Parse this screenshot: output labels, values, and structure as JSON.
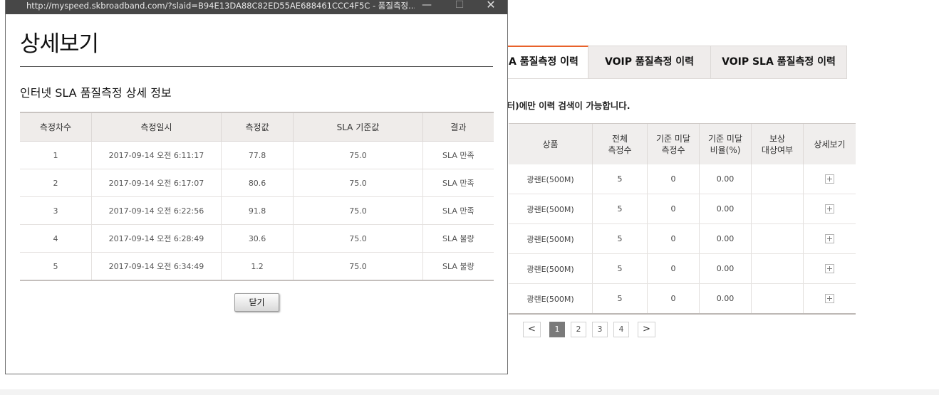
{
  "window": {
    "url": "http://myspeed.skbroadband.com/?slaid=B94E13DA88C82ED55AE688461CCC4F5C - 품질측정...",
    "controls": {
      "minimize": "—",
      "maximize": "☐",
      "close": "✕"
    }
  },
  "popup": {
    "title": "상세보기",
    "subtitle": "인터넷 SLA 품질측정 상세 정보",
    "table": {
      "headers": [
        "측정차수",
        "측정일시",
        "측정값",
        "SLA 기준값",
        "결과"
      ],
      "rows": [
        [
          "1",
          "2017-09-14 오전 6:11:17",
          "77.8",
          "75.0",
          "SLA 만족"
        ],
        [
          "2",
          "2017-09-14 오전 6:17:07",
          "80.6",
          "75.0",
          "SLA 만족"
        ],
        [
          "3",
          "2017-09-14 오전 6:22:56",
          "91.8",
          "75.0",
          "SLA 만족"
        ],
        [
          "4",
          "2017-09-14 오전 6:28:49",
          "30.6",
          "75.0",
          "SLA 불량"
        ],
        [
          "5",
          "2017-09-14 오전 6:34:49",
          "1.2",
          "75.0",
          "SLA 불량"
        ]
      ]
    },
    "close_label": "닫기"
  },
  "page": {
    "tabs": [
      "A 품질측정 이력",
      "VOIP 품질측정 이력",
      "VOIP SLA 품질측정 이력"
    ],
    "notice": "이터)에만 이력 검색이 가능합니다.",
    "list": {
      "headers": [
        "상품",
        "전체\n측정수",
        "기준 미달\n측정수",
        "기준 미달\n비율(%)",
        "보상\n대상여부",
        "상세보기"
      ],
      "rows": [
        [
          "광랜E(500M)",
          "5",
          "0",
          "0.00",
          ""
        ],
        [
          "광랜E(500M)",
          "5",
          "0",
          "0.00",
          ""
        ],
        [
          "광랜E(500M)",
          "5",
          "0",
          "0.00",
          ""
        ],
        [
          "광랜E(500M)",
          "5",
          "0",
          "0.00",
          ""
        ],
        [
          "광랜E(500M)",
          "5",
          "0",
          "0.00",
          ""
        ]
      ]
    },
    "pager": {
      "prev": "<",
      "pages": [
        "1",
        "2",
        "3",
        "4"
      ],
      "current": "1",
      "next": ">"
    }
  },
  "colors": {
    "active_tab_accent": "#e8612a",
    "titlebar": "#474747"
  }
}
